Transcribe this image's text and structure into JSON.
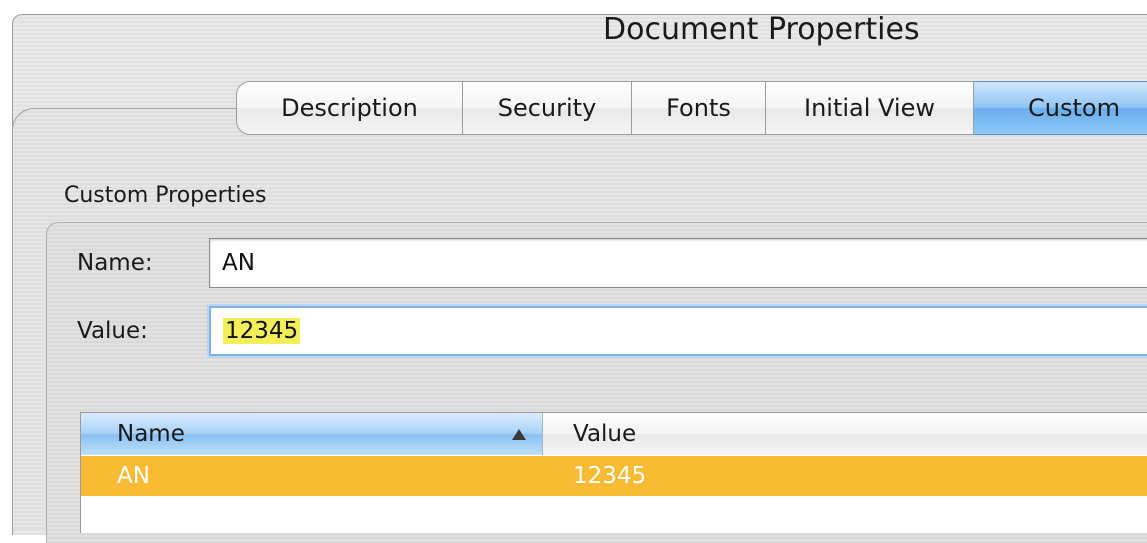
{
  "window": {
    "title": "Document Properties"
  },
  "tabs": [
    {
      "label": "Description",
      "active": false
    },
    {
      "label": "Security",
      "active": false
    },
    {
      "label": "Fonts",
      "active": false
    },
    {
      "label": "Initial View",
      "active": false
    },
    {
      "label": "Custom",
      "active": true
    }
  ],
  "custom_properties": {
    "section_label": "Custom Properties",
    "name_label": "Name:",
    "name_value": "AN",
    "value_label": "Value:",
    "value_value": "12345"
  },
  "table": {
    "columns": [
      "Name",
      "Value"
    ],
    "sort_column": "Name",
    "sort_direction": "ascending",
    "rows": [
      {
        "name": "AN",
        "value": "12345",
        "selected": true
      }
    ]
  },
  "colors": {
    "active_tab": "#8ec8f7",
    "selected_row": "#f9bb33",
    "text_highlight": "#f3ef5b"
  }
}
